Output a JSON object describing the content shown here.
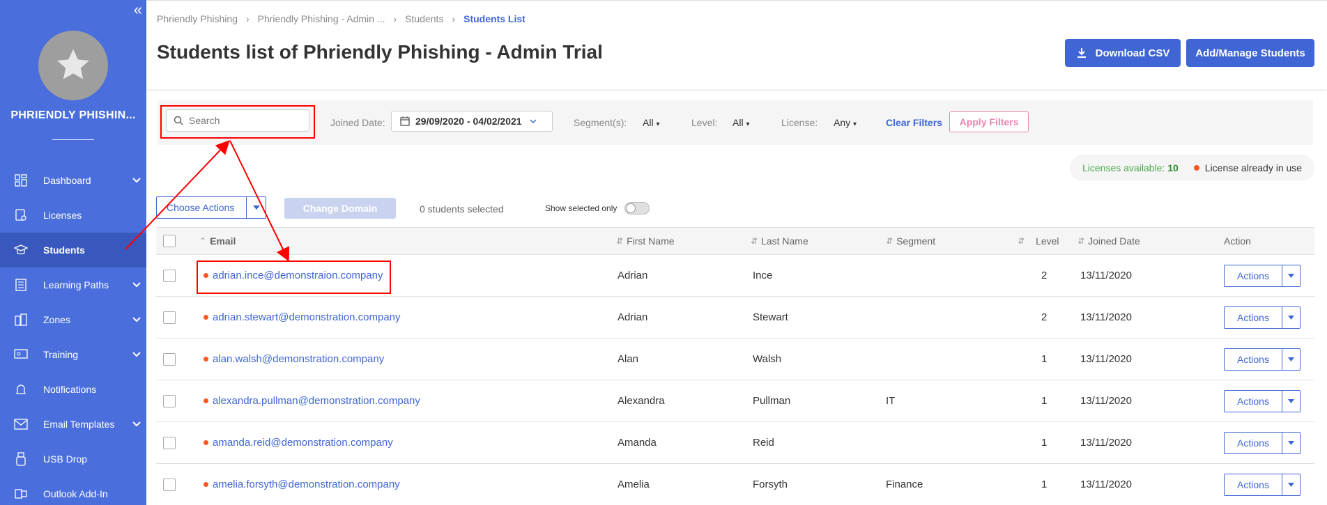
{
  "sidebar": {
    "collapse_icon": "double-chevron-left-icon",
    "org_name": "PHRIENDLY PHISHIN...",
    "items": [
      {
        "label": "Dashboard",
        "icon": "dashboard-icon",
        "expandable": true
      },
      {
        "label": "Licenses",
        "icon": "license-icon",
        "expandable": false
      },
      {
        "label": "Students",
        "icon": "student-icon",
        "expandable": false,
        "active": true
      },
      {
        "label": "Learning Paths",
        "icon": "learning-path-icon",
        "expandable": true
      },
      {
        "label": "Zones",
        "icon": "zones-icon",
        "expandable": true
      },
      {
        "label": "Training",
        "icon": "training-icon",
        "expandable": true
      },
      {
        "label": "Notifications",
        "icon": "bell-icon",
        "expandable": false
      },
      {
        "label": "Email Templates",
        "icon": "email-icon",
        "expandable": true
      },
      {
        "label": "USB Drop",
        "icon": "usb-icon",
        "expandable": false
      },
      {
        "label": "Outlook Add-In",
        "icon": "outlook-icon",
        "expandable": false
      }
    ]
  },
  "breadcrumb": {
    "items": [
      "Phriendly Phishing",
      "Phriendly Phishing - Admin ...",
      "Students"
    ],
    "current": "Students List"
  },
  "page_title": "Students list of Phriendly Phishing - Admin Trial",
  "buttons": {
    "download_csv": "Download CSV",
    "add_manage": "Add/Manage Students"
  },
  "filters": {
    "search_placeholder": "Search",
    "joined_date_label": "Joined Date:",
    "joined_date_value": "29/09/2020 - 04/02/2021",
    "segment_label": "Segment(s):",
    "segment_value": "All",
    "level_label": "Level:",
    "level_value": "All",
    "license_label": "License:",
    "license_value": "Any",
    "clear": "Clear Filters",
    "apply": "Apply Filters"
  },
  "licenses": {
    "available_label": "Licenses available:",
    "available_count": "10",
    "in_use_label": "License already in use"
  },
  "actions_bar": {
    "choose_actions": "Choose Actions",
    "change_domain": "Change Domain",
    "selected_count": "0 students selected",
    "show_selected": "Show selected only"
  },
  "table": {
    "headers": {
      "email": "Email",
      "first_name": "First Name",
      "last_name": "Last Name",
      "segment": "Segment",
      "level": "Level",
      "joined_date": "Joined Date",
      "action": "Action"
    },
    "action_label": "Actions",
    "rows": [
      {
        "email": "adrian.ince@demonstraion.company",
        "first_name": "Adrian",
        "last_name": "Ince",
        "segment": "",
        "level": "2",
        "joined": "13/11/2020"
      },
      {
        "email": "adrian.stewart@demonstration.company",
        "first_name": "Adrian",
        "last_name": "Stewart",
        "segment": "",
        "level": "2",
        "joined": "13/11/2020"
      },
      {
        "email": "alan.walsh@demonstration.company",
        "first_name": "Alan",
        "last_name": "Walsh",
        "segment": "",
        "level": "1",
        "joined": "13/11/2020"
      },
      {
        "email": "alexandra.pullman@demonstration.company",
        "first_name": "Alexandra",
        "last_name": "Pullman",
        "segment": "IT",
        "level": "1",
        "joined": "13/11/2020"
      },
      {
        "email": "amanda.reid@demonstration.company",
        "first_name": "Amanda",
        "last_name": "Reid",
        "segment": "",
        "level": "1",
        "joined": "13/11/2020"
      },
      {
        "email": "amelia.forsyth@demonstration.company",
        "first_name": "Amelia",
        "last_name": "Forsyth",
        "segment": "Finance",
        "level": "1",
        "joined": "13/11/2020"
      }
    ]
  },
  "colors": {
    "sidebar": "#4a6fdc",
    "sidebar_active": "#3858bd",
    "primary": "#3f66d4",
    "annotation": "#ff0000",
    "license_dot": "#ff5722"
  }
}
